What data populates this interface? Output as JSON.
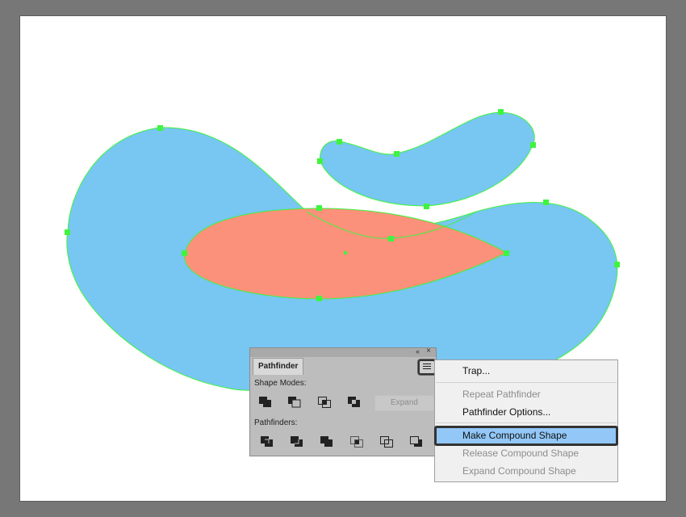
{
  "colors": {
    "canvas_bg": "#777777",
    "artboard_bg": "#ffffff",
    "shape_blue": "#78c6f2",
    "shape_salmon": "#fb917a",
    "anchor_green": "#3ef43e",
    "menu_highlight": "#92c7f7"
  },
  "pathfinder": {
    "tab_label": "Pathfinder",
    "collapse_icon": "«",
    "close_icon": "×",
    "shape_modes_label": "Shape Modes:",
    "pathfinders_label": "Pathfinders:",
    "expand_label": "Expand",
    "shape_mode_icons": [
      "unite-icon",
      "minus-front-icon",
      "intersect-icon",
      "exclude-icon"
    ],
    "pathfinder_icons": [
      "divide-icon",
      "trim-icon",
      "merge-icon",
      "crop-icon",
      "outline-icon",
      "minus-back-icon"
    ]
  },
  "flyout_menu": {
    "items": [
      {
        "label": "Trap...",
        "enabled": true
      },
      {
        "label": "Repeat Pathfinder",
        "enabled": false
      },
      {
        "label": "Pathfinder Options...",
        "enabled": true
      },
      {
        "label": "Make Compound Shape",
        "enabled": true,
        "highlighted": true
      },
      {
        "label": "Release Compound Shape",
        "enabled": false
      },
      {
        "label": "Expand Compound Shape",
        "enabled": false
      }
    ]
  }
}
